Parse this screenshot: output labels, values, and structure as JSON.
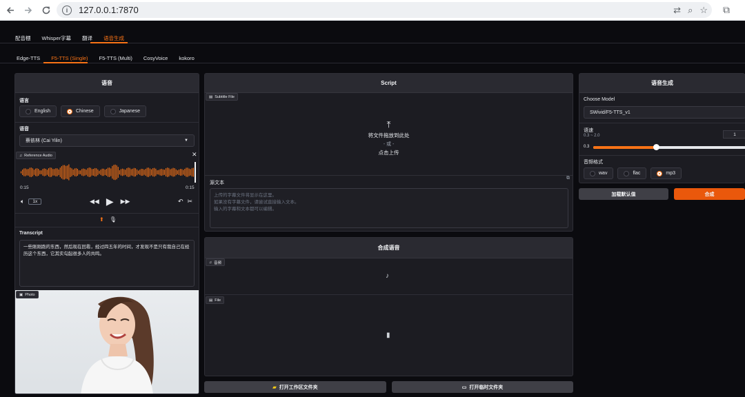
{
  "browser": {
    "url": "127.0.0.1:7870"
  },
  "tabs_main": [
    "配音棚",
    "Whisper字幕",
    "翻译",
    "语音生成"
  ],
  "tabs_sub": [
    "Edge-TTS",
    "F5-TTS (Single)",
    "F5-TTS (Multi)",
    "CosyVoice",
    "kokoro"
  ],
  "left": {
    "title": "语音",
    "lang_label": "语言",
    "langs": [
      "English",
      "Chinese",
      "Japanese"
    ],
    "voice_label": "语音",
    "voice_value": "蔡依林 (Cai Yilin)",
    "ref_audio_tag": "Reference Audio",
    "time_start": "0:15",
    "time_end": "0:15",
    "speed": "1x",
    "transcript_label": "Transcript",
    "transcript": "一些刚刚跑的东西，然后现在回看，经过四五年的时间，才发现不是只有我自己在经历这个东西，它其实勾起很多人的共鸣。",
    "photo_tag": "Photo"
  },
  "middle": {
    "script_title": "Script",
    "subtitle_tag": "Subtitle File",
    "drop_line1": "将文件拖放到此处",
    "drop_line2": "- 或 -",
    "drop_line3": "点击上传",
    "source_label": "源文本",
    "source_placeholder": "上传的字幕文件将显示在这里。\n如果没有字幕文件，请尝试直接输入文本。\n输入的字幕和文本都可以编辑。",
    "synth_title": "合成语音",
    "audio_tag": "音频",
    "file_tag": "File",
    "open_workspace": "打开工作区文件夹",
    "open_temp": "打开临时文件夹"
  },
  "right": {
    "title": "语音生成",
    "model_label": "Choose Model",
    "model_value": "SWivid/F5-TTS_v1",
    "speed_label": "语速",
    "speed_range": "0.3 ~ 2.0",
    "speed_value": 1,
    "slider_min": "0.3",
    "slider_fraction": 0.41,
    "format_label": "音频格式",
    "formats": [
      "wav",
      "flac",
      "mp3"
    ],
    "btn_default": "加载默认值",
    "btn_synth": "合成"
  },
  "colors": {
    "accent": "#f97316",
    "panel": "#1c1c22",
    "header": "#2a2a31"
  }
}
